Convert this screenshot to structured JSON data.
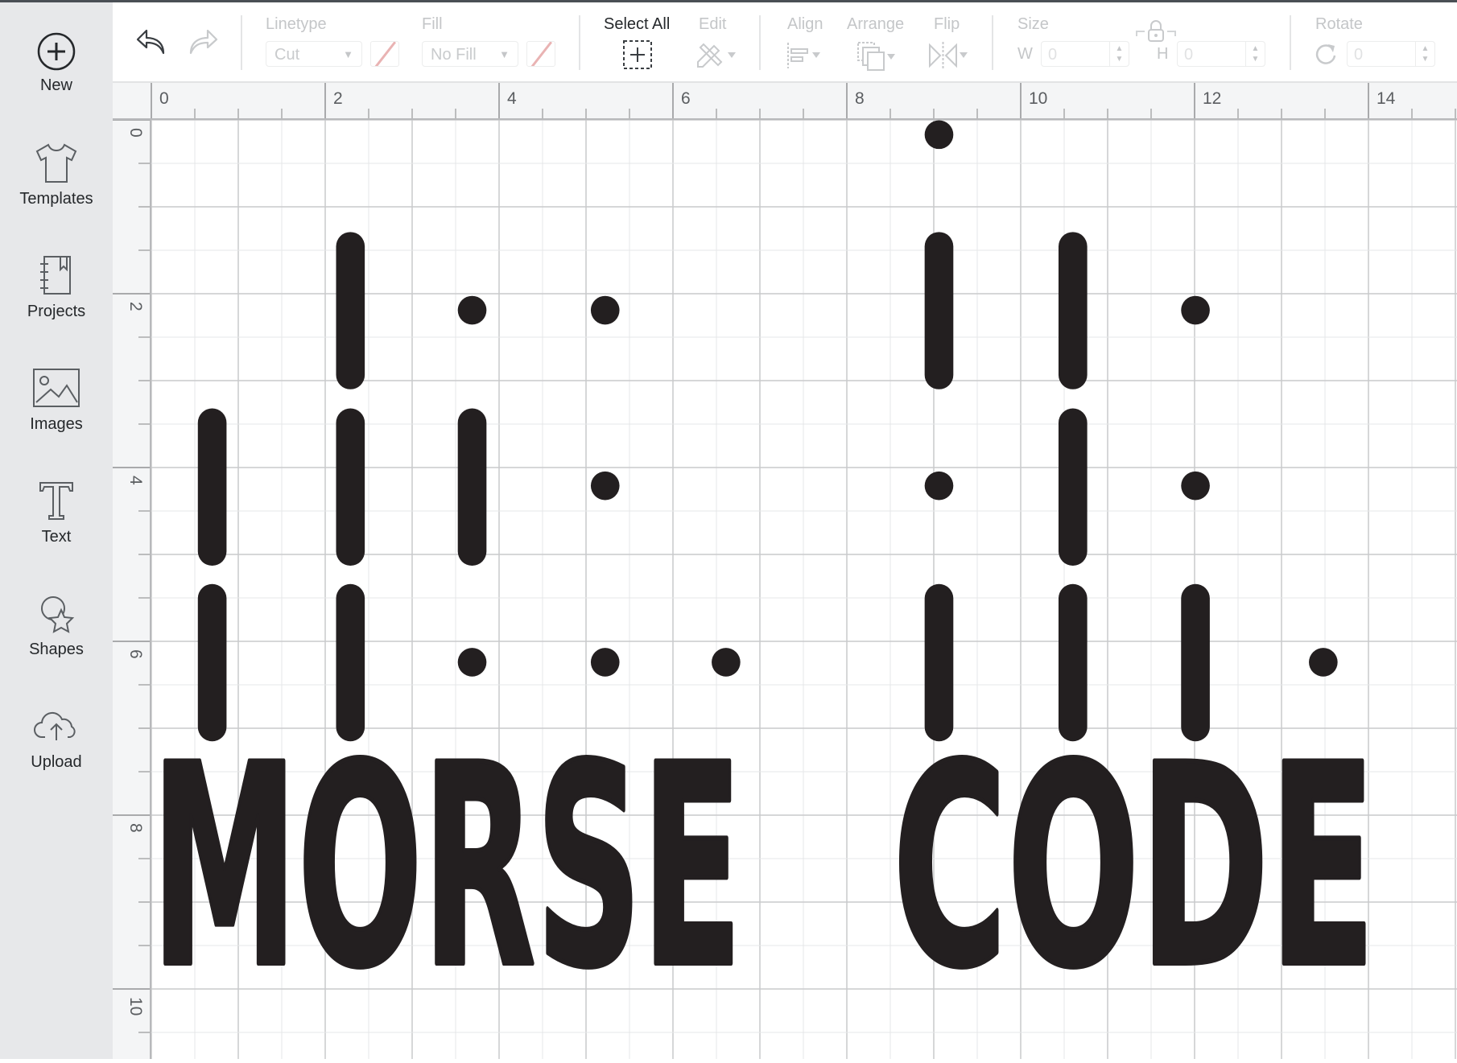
{
  "sidebar": {
    "items": [
      {
        "label": "New",
        "icon": "plus-circle-icon"
      },
      {
        "label": "Templates",
        "icon": "tshirt-icon"
      },
      {
        "label": "Projects",
        "icon": "notebook-icon"
      },
      {
        "label": "Images",
        "icon": "image-icon"
      },
      {
        "label": "Text",
        "icon": "text-icon"
      },
      {
        "label": "Shapes",
        "icon": "shapes-icon"
      },
      {
        "label": "Upload",
        "icon": "cloud-upload-icon"
      }
    ]
  },
  "toolbar": {
    "linetype_label": "Linetype",
    "linetype_value": "Cut",
    "fill_label": "Fill",
    "fill_value": "No Fill",
    "select_all_label": "Select All",
    "edit_label": "Edit",
    "align_label": "Align",
    "arrange_label": "Arrange",
    "flip_label": "Flip",
    "size_label": "Size",
    "w_label": "W",
    "w_value": "0",
    "h_label": "H",
    "h_value": "0",
    "rotate_label": "Rotate",
    "rotate_value": "0",
    "swatch_color": "#e9b3b3"
  },
  "rulers": {
    "top_labels": [
      "0",
      "2",
      "4",
      "6",
      "8",
      "10",
      "12",
      "14"
    ],
    "left_labels": [
      "0",
      "2",
      "4",
      "6",
      "8",
      "10"
    ]
  },
  "design": {
    "color": "#231f20",
    "words": [
      "MORSE",
      "CODE"
    ],
    "dots": [
      [
        9.06,
        0.17
      ],
      [
        3.69,
        2.19
      ],
      [
        5.22,
        2.19
      ],
      [
        12.01,
        2.19
      ],
      [
        5.22,
        4.21
      ],
      [
        9.06,
        4.21
      ],
      [
        12.01,
        4.21
      ],
      [
        3.69,
        6.24
      ],
      [
        5.22,
        6.24
      ],
      [
        6.61,
        6.24
      ],
      [
        13.48,
        6.24
      ]
    ],
    "dashes": [
      [
        2.29,
        1.29
      ],
      [
        9.06,
        1.29
      ],
      [
        10.6,
        1.29
      ],
      [
        0.7,
        3.32
      ],
      [
        2.29,
        3.32
      ],
      [
        3.69,
        3.32
      ],
      [
        10.6,
        3.32
      ],
      [
        0.7,
        5.34
      ],
      [
        2.29,
        5.34
      ],
      [
        9.06,
        5.34
      ],
      [
        10.6,
        5.34
      ],
      [
        12.01,
        5.34
      ]
    ]
  }
}
